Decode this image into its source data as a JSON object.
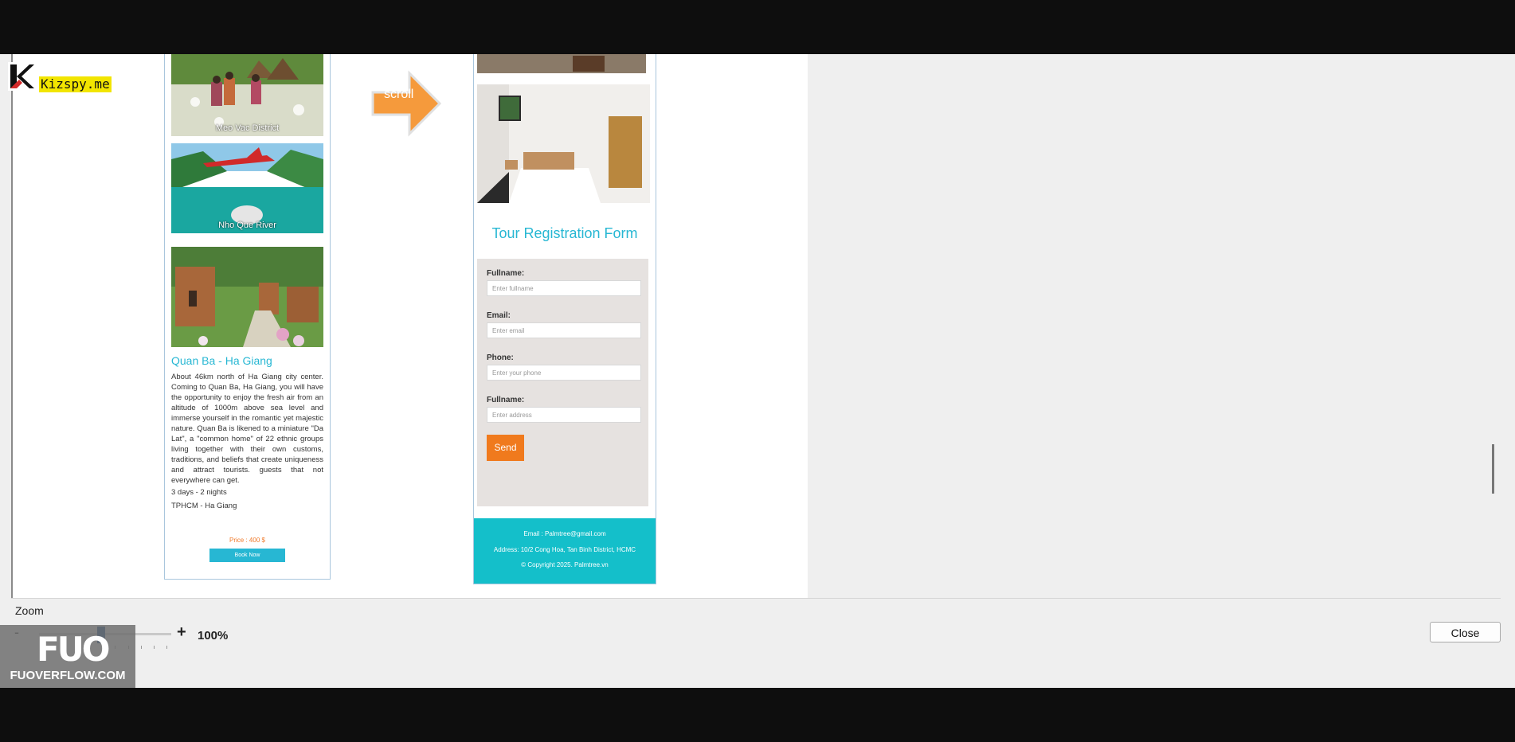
{
  "watermarks": {
    "top_left": "Kizspy.me",
    "bottom_left_mark": "FUO",
    "bottom_left_text": "FUOVERFLOW.COM"
  },
  "left_page": {
    "tiles": [
      {
        "caption": "Meo Vac District"
      },
      {
        "caption": "Nho Que River"
      }
    ],
    "title": "Quan Ba - Ha Giang",
    "description": "About 46km north of Ha Giang city center. Coming to Quan Ba, Ha Giang, you will have the opportunity to enjoy the fresh air from an altitude of 1000m above sea level and immerse yourself in the romantic yet majestic nature. Quan Ba is likened to a miniature \"Da Lat\", a \"common home\" of 22 ethnic groups living together with their own customs, traditions, and beliefs that create uniqueness and attract tourists. guests that not everywhere can get.",
    "duration": "3 days - 2 nights",
    "route": "TPHCM - Ha Giang",
    "price": "Price : 400 $",
    "book_label": "Book Now"
  },
  "arrow_label": "scroll",
  "right_page": {
    "form_title": "Tour Registration Form",
    "fields": [
      {
        "label": "Fullname:",
        "placeholder": "Enter fullname"
      },
      {
        "label": "Email:",
        "placeholder": "Enter email"
      },
      {
        "label": "Phone:",
        "placeholder": "Enter your phone"
      },
      {
        "label": "Fullname:",
        "placeholder": "Enter address"
      }
    ],
    "send_label": "Send",
    "footer": {
      "email": "Email : Palmtree@gmail.com",
      "address": "Address: 10/2 Cong Hoa, Tan Binh District, HCMC",
      "copyright": "© Copyright 2025. Palmtree.vn"
    }
  },
  "zoom": {
    "label": "Zoom",
    "minus": "-",
    "plus": "+",
    "value": "100%",
    "slider_fraction": 0.47
  },
  "close_label": "Close",
  "colors": {
    "accent_cyan": "#27b7d3",
    "orange": "#f07a1d",
    "footer_teal": "#14bfca",
    "slider_thumb": "#0f4c8a"
  }
}
